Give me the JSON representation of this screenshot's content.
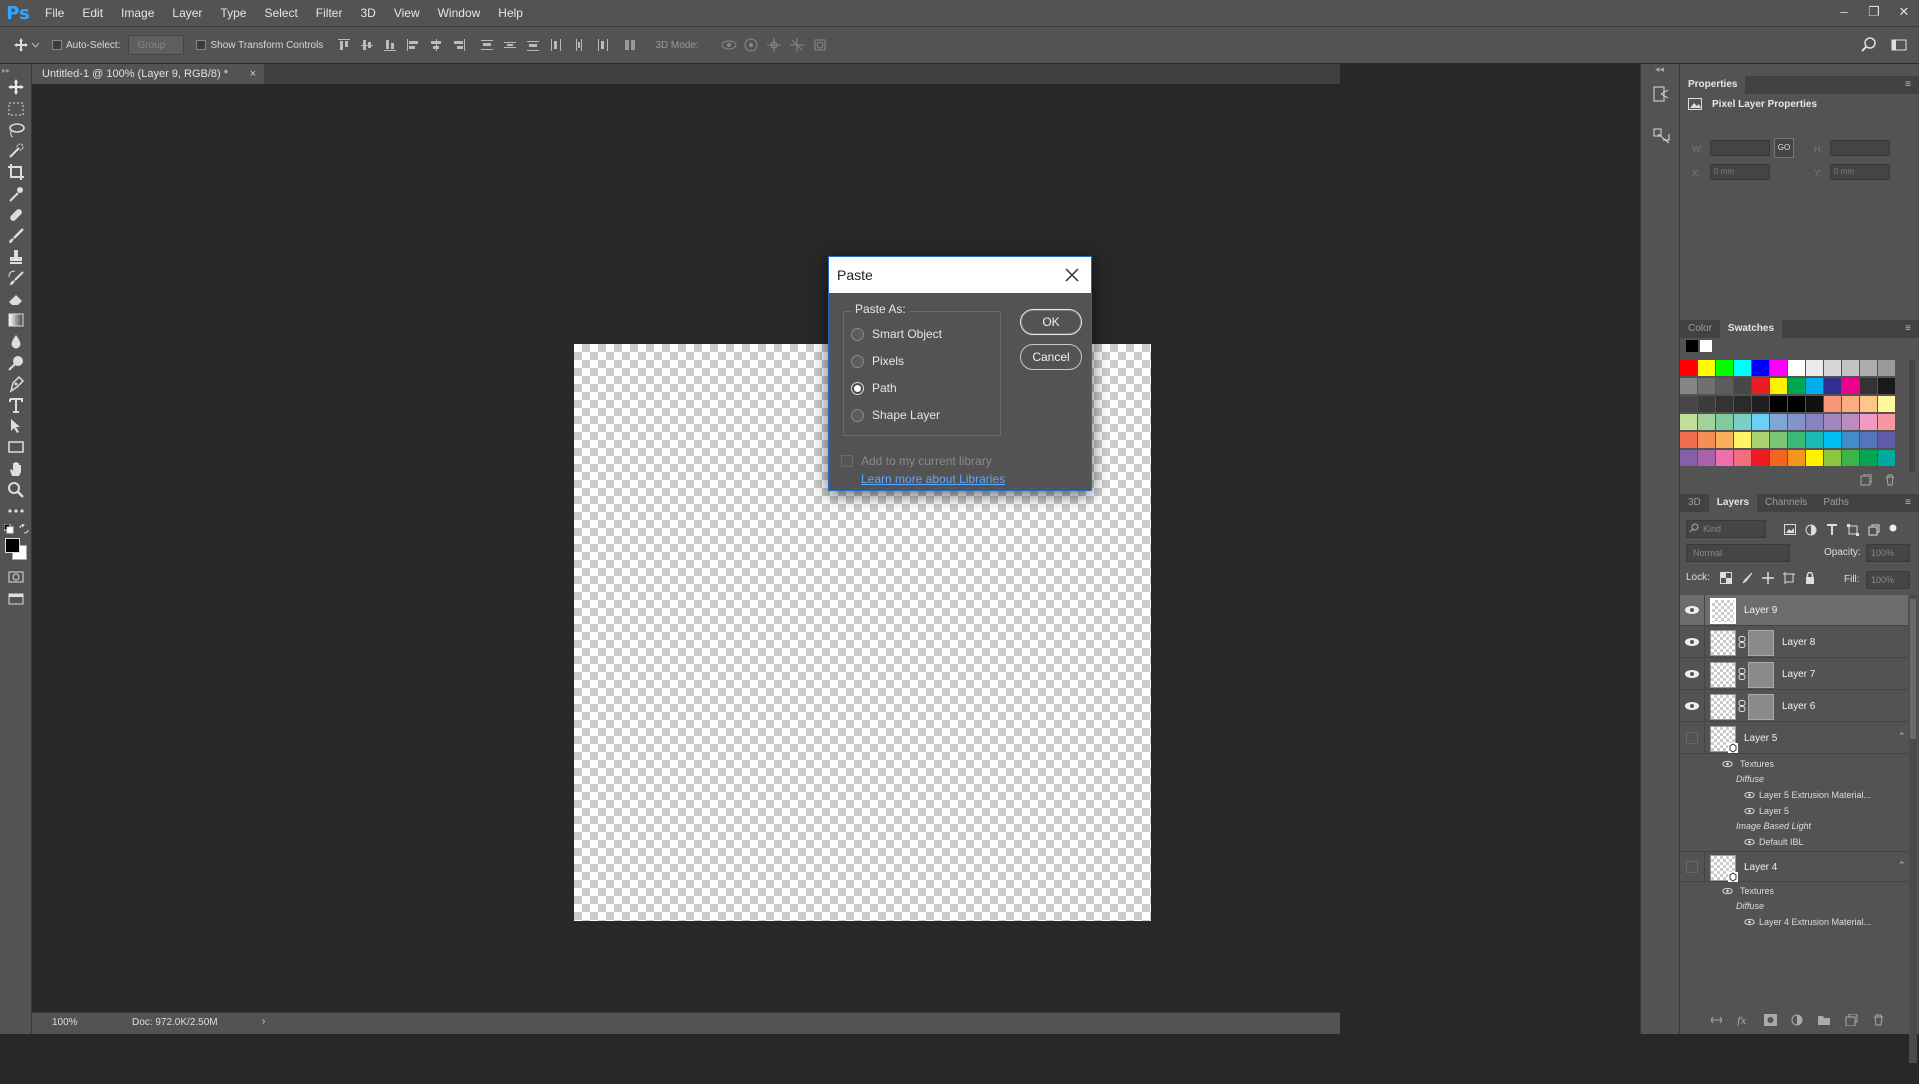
{
  "app": {
    "logo": "Ps"
  },
  "menu": [
    "File",
    "Edit",
    "Image",
    "Layer",
    "Type",
    "Select",
    "Filter",
    "3D",
    "View",
    "Window",
    "Help"
  ],
  "window_controls": {
    "minimize": "–",
    "restore": "❐",
    "close": "✕"
  },
  "options": {
    "auto_select_label": "Auto-Select:",
    "auto_select_value": "Group",
    "show_transform_label": "Show Transform Controls",
    "mode3d_label": "3D Mode:"
  },
  "document_tab": {
    "title": "Untitled-1 @ 100% (Layer 9, RGB/8) *",
    "close": "×"
  },
  "status": {
    "zoom": "100%",
    "doc_size": "Doc: 972.0K/2.50M",
    "arrow": "›"
  },
  "properties": {
    "tab": "Properties",
    "header": "Pixel Layer Properties",
    "w_label": "W:",
    "h_label": "H:",
    "x_label": "X:",
    "y_label": "Y:",
    "x_value": "0 mm",
    "y_value": "0 mm",
    "link_icon": "GO"
  },
  "swatch_panel": {
    "tabs": [
      "Color",
      "Swatches"
    ],
    "active_tab": "Swatches",
    "swatch_rows": [
      [
        "#ff0000",
        "#ffff00",
        "#00ff00",
        "#00ffff",
        "#0000ff",
        "#ff00ff",
        "#ffffff",
        "#ebebeb",
        "#d6d6d6",
        "#c2c2c2",
        "#adadad",
        "#999999"
      ],
      [
        "#858585",
        "#707070",
        "#5c5c5c",
        "#474747",
        "#ed1c24",
        "#fff200",
        "#00a651",
        "#00aeef",
        "#2e3192",
        "#ec008c",
        "#333333",
        "#1a1a1a"
      ],
      [
        "#464646",
        "#3c3c3c",
        "#333333",
        "#2a2a2a",
        "#1f1f1f",
        "#000000",
        "#000000",
        "#111111",
        "#f7977a",
        "#f9ad81",
        "#fdc68a",
        "#fff79a"
      ],
      [
        "#c4df9b",
        "#a3d39c",
        "#82ca9d",
        "#7bcdc8",
        "#6ecff6",
        "#7ea7d8",
        "#8493ca",
        "#8882be",
        "#a187be",
        "#bc8cbf",
        "#f49ac2",
        "#f6989d"
      ],
      [
        "#f26c4f",
        "#f68e55",
        "#fbaf5c",
        "#fff467",
        "#acd372",
        "#7cc576",
        "#3bb878",
        "#1abbb4",
        "#00bff3",
        "#438ccb",
        "#5574b9",
        "#605ca8"
      ],
      [
        "#8560a8",
        "#a863a8",
        "#f06eaa",
        "#f26d7d",
        "#ed1c24",
        "#f26522",
        "#f7941d",
        "#fff200",
        "#8dc73f",
        "#39b54a",
        "#00a651",
        "#00a99d"
      ]
    ]
  },
  "layers_panel": {
    "tabs": [
      "3D",
      "Layers",
      "Channels",
      "Paths"
    ],
    "active_tab": "Layers",
    "filter_kind": "Kind",
    "blend_mode": "Normal",
    "opacity_label": "Opacity:",
    "opacity_value": "100%",
    "lock_label": "Lock:",
    "fill_label": "Fill:",
    "fill_value": "100%",
    "layers": [
      {
        "name": "Layer 9",
        "visible": true,
        "selected": true,
        "mask": false
      },
      {
        "name": "Layer 8",
        "visible": true,
        "selected": false,
        "mask": true
      },
      {
        "name": "Layer 7",
        "visible": true,
        "selected": false,
        "mask": true
      },
      {
        "name": "Layer 6",
        "visible": true,
        "selected": false,
        "mask": true
      },
      {
        "name": "Layer 5",
        "visible": false,
        "selected": false,
        "mask": false,
        "is3d": true
      }
    ],
    "layer5_sub": {
      "textures": "Textures",
      "diffuse": "Diffuse",
      "material": "Layer 5 Extrusion Material...",
      "layer": "Layer 5",
      "ibl_group": "Image Based Light",
      "ibl": "Default IBL"
    },
    "layer4": {
      "name": "Layer 4"
    },
    "layer4_sub": {
      "textures": "Textures",
      "diffuse": "Diffuse",
      "material": "Layer 4 Extrusion Material..."
    }
  },
  "paste_dialog": {
    "title": "Paste",
    "group_label": "Paste As:",
    "options": [
      "Smart Object",
      "Pixels",
      "Path",
      "Shape Layer"
    ],
    "selected": "Path",
    "ok": "OK",
    "cancel": "Cancel",
    "library_checkbox": "Add to my current library",
    "library_link": "Learn more about Libraries"
  },
  "colors": {
    "accent": "#31a8ff",
    "link": "#5aa8ff",
    "dialog_border": "#1e6bc8"
  }
}
